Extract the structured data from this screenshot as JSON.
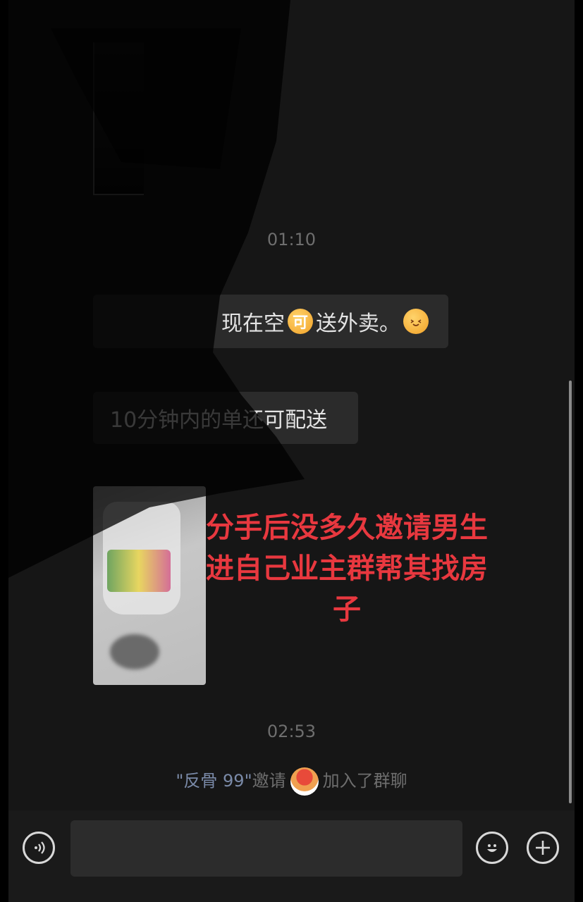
{
  "chat": {
    "time_1": "01:10",
    "msg_1_part_1": "现在空",
    "msg_1_badge": "可",
    "msg_1_part_2": "送外卖。",
    "msg_2": "10分钟内的单还可配送",
    "overlay_caption": "分手后没多久邀请男生进自己业主群帮其找房子",
    "time_2": "02:53",
    "system_inviter": "\"反骨 99\"",
    "system_text_1": "邀请",
    "system_text_2": "加入了群聊"
  },
  "icons": [
    "voice-icon",
    "emoji-icon",
    "plus-icon",
    "smile-emoji-icon"
  ],
  "colors": {
    "caption_red": "#e8383f",
    "bubble_bg": "#2b2b2b",
    "chat_bg": "#161616"
  }
}
